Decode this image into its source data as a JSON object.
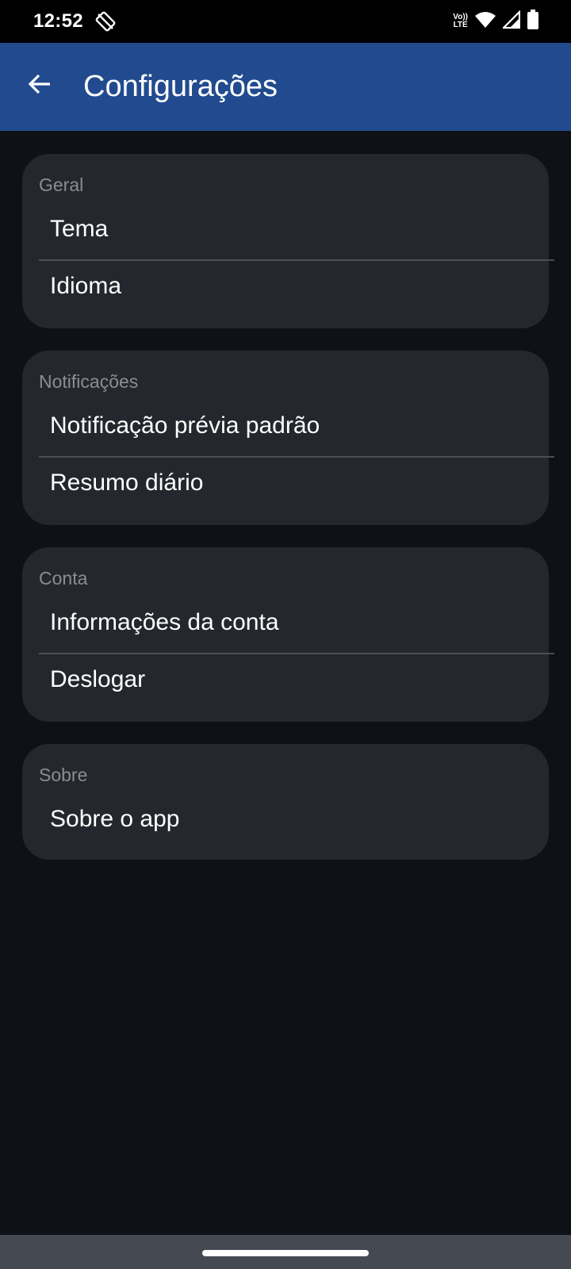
{
  "status_bar": {
    "time": "12:52",
    "network_label_top": "Vo))",
    "network_label_bottom": "LTE",
    "icons": [
      "rotate-icon",
      "wifi-icon",
      "signal-icon",
      "battery-icon"
    ]
  },
  "app_bar": {
    "title": "Configurações",
    "back_icon": "arrow-left-icon",
    "color": "#224b8f"
  },
  "sections": [
    {
      "title": "Geral",
      "items": [
        "Tema",
        "Idioma"
      ]
    },
    {
      "title": "Notificações",
      "items": [
        "Notificação prévia padrão",
        "Resumo diário"
      ]
    },
    {
      "title": "Conta",
      "items": [
        "Informações da conta",
        "Deslogar"
      ]
    },
    {
      "title": "Sobre",
      "items": [
        "Sobre o app"
      ]
    }
  ],
  "colors": {
    "background": "#0e1116",
    "card": "#24272d",
    "section_title": "#8a8d92"
  }
}
